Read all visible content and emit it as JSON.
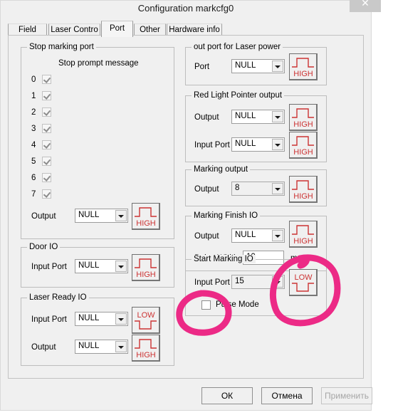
{
  "window": {
    "title": "Configuration markcfg0",
    "close_icon": "close-icon",
    "close_label": "✕"
  },
  "tabs": [
    {
      "label": "Field",
      "active": false
    },
    {
      "label": "Laser Contro",
      "active": false
    },
    {
      "label": "Port",
      "active": true
    },
    {
      "label": "Other",
      "active": false
    },
    {
      "label": "Hardware info",
      "active": false
    }
  ],
  "groups": {
    "stop_marking_port": {
      "title": "Stop marking port",
      "prompt_header": "Stop prompt message",
      "rows": [
        {
          "index": "0",
          "checked": true
        },
        {
          "index": "1",
          "checked": true
        },
        {
          "index": "2",
          "checked": true
        },
        {
          "index": "3",
          "checked": true
        },
        {
          "index": "4",
          "checked": true
        },
        {
          "index": "5",
          "checked": true
        },
        {
          "index": "6",
          "checked": true
        },
        {
          "index": "7",
          "checked": true
        }
      ],
      "output_label": "Output",
      "output_value": "NULL",
      "output_level": "HIGH"
    },
    "door_io": {
      "title": "Door IO",
      "input_label": "Input Port",
      "input_value": "NULL",
      "input_level": "HIGH"
    },
    "laser_ready_io": {
      "title": "Laser Ready IO",
      "input_label": "Input Port",
      "input_value": "NULL",
      "input_level": "LOW",
      "output_label": "Output",
      "output_value": "NULL",
      "output_level": "HIGH"
    },
    "out_port_laser_power": {
      "title": "out port for Laser power",
      "port_label": "Port",
      "port_value": "NULL",
      "port_level": "HIGH"
    },
    "red_light_pointer": {
      "title": "Red Light Pointer output",
      "output_label": "Output",
      "output_value": "NULL",
      "output_level": "HIGH",
      "input_label": "Input Port",
      "input_value": "NULL",
      "input_level": "HIGH"
    },
    "marking_output": {
      "title": "Marking output",
      "output_label": "Output",
      "output_value": "8",
      "output_level": "HIGH"
    },
    "marking_finish_io": {
      "title": "Marking Finish IO",
      "output_label": "Output",
      "output_value": "NULL",
      "output_level": "HIGH",
      "pulse_width_label": "Pulse Width",
      "pulse_width_value": "10",
      "pulse_width_unit": "ms"
    },
    "start_marking_io": {
      "title": "Start Marking IO",
      "input_label": "Input Port",
      "input_value": "15",
      "input_level": "LOW",
      "pulse_mode_label": "Pulse Mode",
      "pulse_mode_checked": false
    }
  },
  "footer": {
    "ok": "ОК",
    "cancel": "Отмена",
    "apply": "Применить"
  },
  "annotation": {
    "ink_color": "#ec2a86",
    "shapes": [
      "circle-around-low-button",
      "circle-around-pulse-mode-checkbox"
    ]
  }
}
